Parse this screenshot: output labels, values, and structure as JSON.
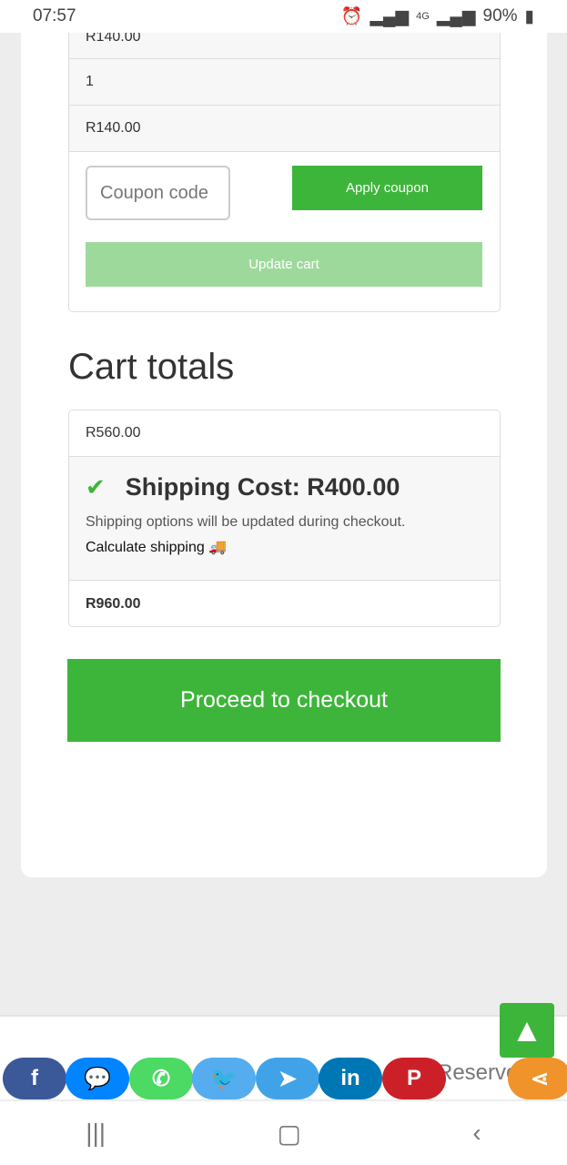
{
  "status": {
    "time": "07:57",
    "network": "4G",
    "battery": "90%"
  },
  "cart": {
    "partial_price": "R140.00",
    "quantity": "1",
    "subtotal": "R140.00",
    "coupon_placeholder": "Coupon code",
    "apply_coupon": "Apply coupon",
    "update_cart": "Update cart"
  },
  "totals": {
    "title": "Cart totals",
    "subtotal": "R560.00",
    "shipping": "Shipping Cost: R400.00",
    "shipping_note": "Shipping options will be updated during checkout.",
    "calculate_shipping": "Calculate shipping",
    "total": "R960.00"
  },
  "checkout": "Proceed to checkout",
  "footer": {
    "text": "Reserved"
  },
  "colors": {
    "accent": "#3db53a",
    "facebook": "#3b5998",
    "messenger": "#0084ff",
    "whatsapp": "#4cd964",
    "twitter": "#55acee",
    "telegram": "#40a3e8",
    "linkedin": "#0077b5",
    "pinterest": "#cb2027",
    "share": "#f0932b"
  },
  "social": [
    "f",
    "m",
    "w",
    "t",
    "tg",
    "in",
    "p",
    "share"
  ]
}
